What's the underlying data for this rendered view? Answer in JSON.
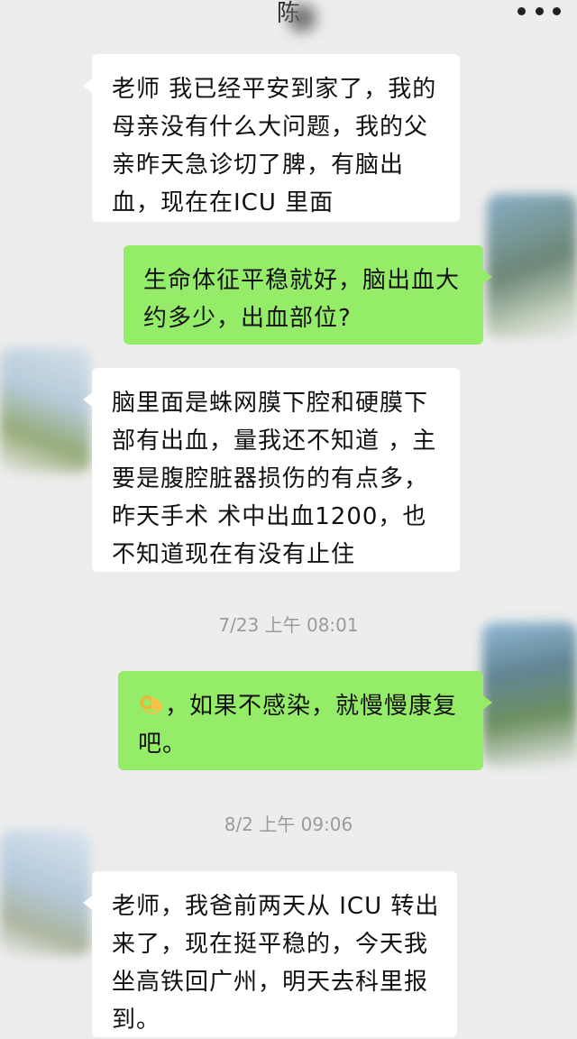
{
  "header": {
    "title": "陈",
    "more_icon": "more-dots-icon"
  },
  "messages": [
    {
      "direction": "received",
      "lines": [
        "老师 我已经平安到家了，我的",
        "母亲没有什么大问题，我的父",
        "亲昨天急诊切了脾，有脑出",
        "血，现在在ICU 里面"
      ]
    },
    {
      "direction": "sent",
      "lines": [
        "生命体征平稳就好，脑出血大",
        "约多少，出血部位?"
      ]
    },
    {
      "direction": "received",
      "lines": [
        "脑里面是蛛网膜下腔和硬膜下",
        "部有出血，量我还不知道 ，主",
        "要是腹腔脏器损伤的有点多，",
        "昨天手术 术中出血1200，也",
        "不知道现在有没有止住"
      ]
    },
    {
      "timestamp": "7/23 上午 08:01"
    },
    {
      "direction": "sent",
      "emoji": "ok-hand-emoji",
      "lines": [
        "，如果不感染，就慢慢康复",
        "吧。"
      ]
    },
    {
      "timestamp": "8/2 上午 09:06"
    },
    {
      "direction": "received",
      "lines": [
        "老师，我爸前两天从 ICU 转出",
        "来了，现在挺平稳的，今天我",
        "坐高铁回广州，明天去科里报",
        "到。"
      ]
    }
  ],
  "colors": {
    "background": "#ededed",
    "sent_bubble": "#95ec69",
    "received_bubble": "#ffffff",
    "timestamp_text": "#9b9b9b"
  }
}
